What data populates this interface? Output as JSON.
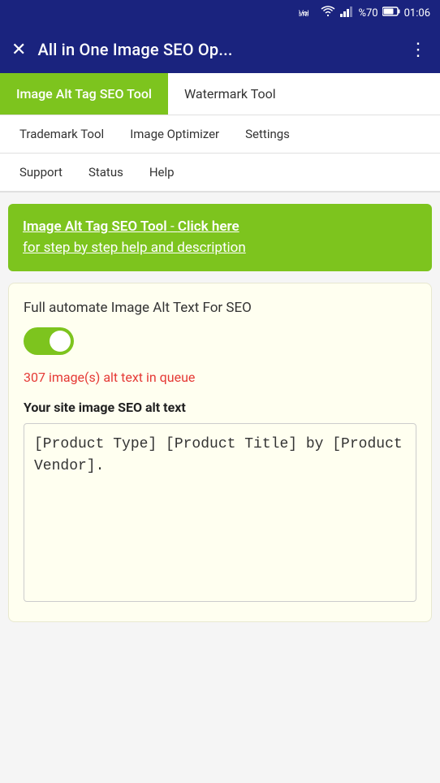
{
  "statusBar": {
    "network": "VoLTE",
    "wifi": "wifi-icon",
    "signal": "signal-icon",
    "battery": "%70",
    "time": "01:06"
  },
  "appBar": {
    "closeIcon": "✕",
    "title": "All in One Image SEO Op...",
    "menuIcon": "⋮"
  },
  "tabs1": [
    {
      "label": "Image Alt Tag SEO Tool",
      "active": true
    },
    {
      "label": "Watermark Tool",
      "active": false
    }
  ],
  "tabs2": [
    {
      "label": "Trademark Tool"
    },
    {
      "label": "Image Optimizer"
    },
    {
      "label": "Settings"
    }
  ],
  "tabs3": [
    {
      "label": "Support"
    },
    {
      "label": "Status"
    },
    {
      "label": "Help"
    }
  ],
  "banner": {
    "toolName": "Image Alt Tag SEO Tool",
    "separator": " - ",
    "clickHere": "Click here",
    "description": "for step by step help and description"
  },
  "mainCard": {
    "toggleLabel": "Full automate Image Alt Text For SEO",
    "toggleEnabled": true,
    "queueText": "307 image(s) alt text in queue",
    "seoAltLabel": "Your site image SEO alt text",
    "altTextValue": "[Product Type] [Product Title] by [Product Vendor]."
  }
}
